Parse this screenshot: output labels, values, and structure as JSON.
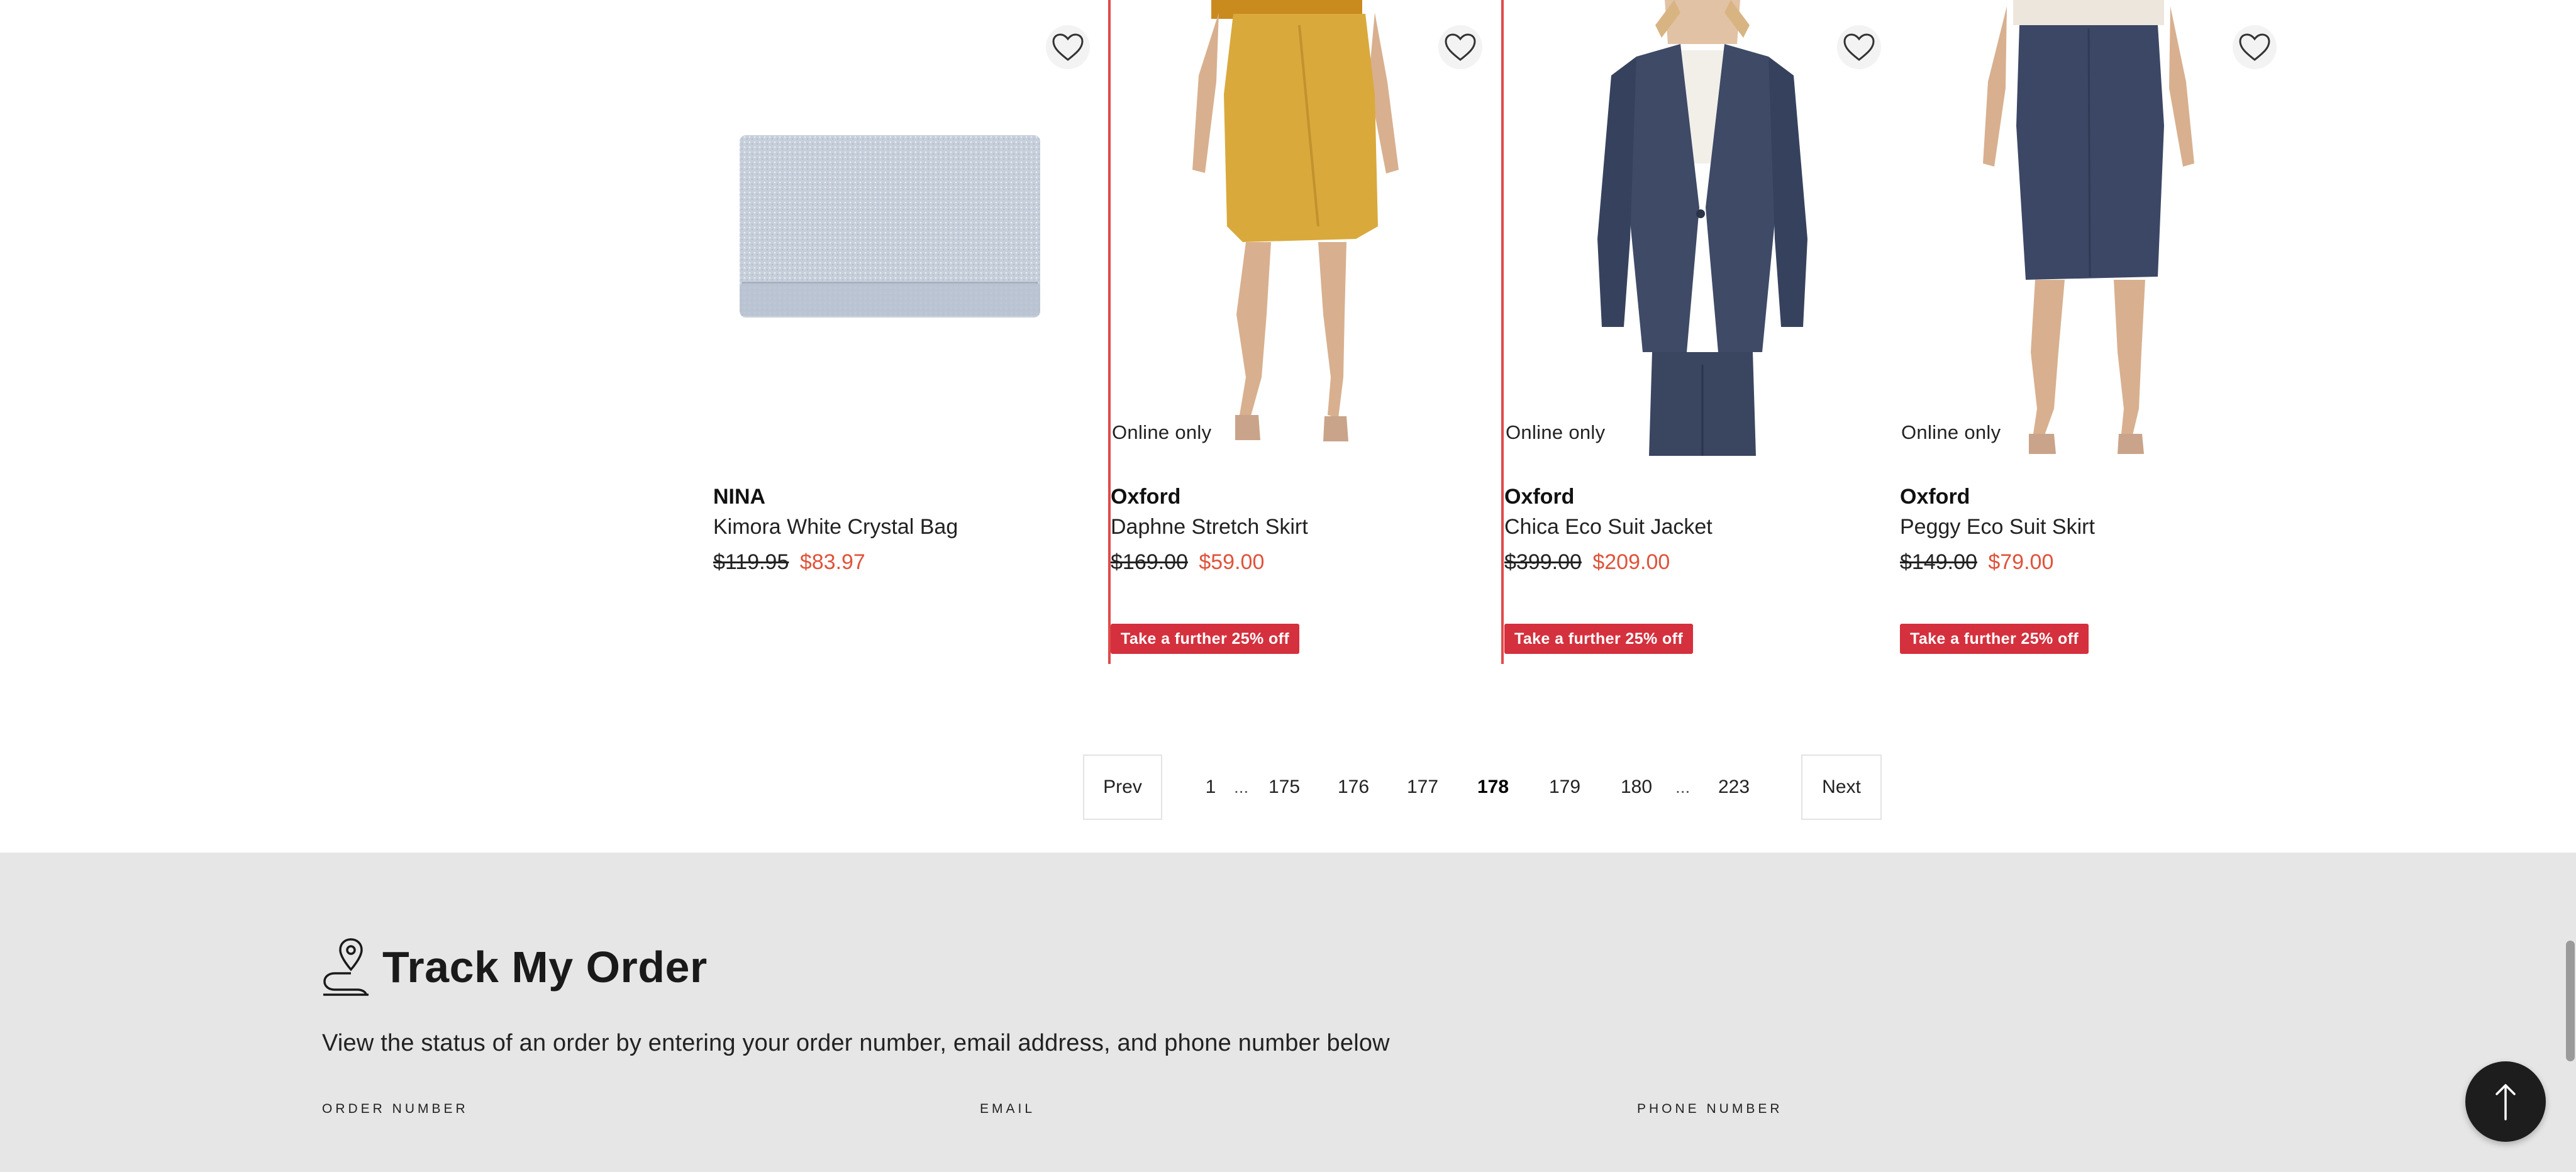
{
  "products": [
    {
      "brand": "NINA",
      "name": "Kimora White Crystal Bag",
      "price_old": "$119.95",
      "price_new": "$83.97",
      "online_badge": "",
      "promo": "",
      "image": "crystal-clutch-bag"
    },
    {
      "brand": "Oxford",
      "name": "Daphne Stretch Skirt",
      "price_old": "$169.00",
      "price_new": "$59.00",
      "online_badge": "Online only",
      "promo": "Take a further 25% off",
      "image": "mustard-wrap-skirt"
    },
    {
      "brand": "Oxford",
      "name": "Chica Eco Suit Jacket",
      "price_old": "$399.00",
      "price_new": "$209.00",
      "online_badge": "Online only",
      "promo": "Take a further 25% off",
      "image": "navy-suit-jacket"
    },
    {
      "brand": "Oxford",
      "name": "Peggy Eco Suit Skirt",
      "price_old": "$149.00",
      "price_new": "$79.00",
      "online_badge": "Online only",
      "promo": "Take a further 25% off",
      "image": "navy-pencil-skirt"
    }
  ],
  "pagination": {
    "prev": "Prev",
    "next": "Next",
    "pages": [
      "1",
      "175",
      "176",
      "177",
      "178",
      "179",
      "180",
      "223"
    ],
    "ellipsis": "...",
    "current": "178"
  },
  "track_order": {
    "title": "Track My Order",
    "description": "View the status of an order by entering your order number, email address, and phone number below",
    "fields": [
      {
        "label": "Order Number",
        "value": ""
      },
      {
        "label": "Email",
        "value": ""
      },
      {
        "label": "Phone Number",
        "value": ""
      }
    ]
  },
  "icons": {
    "wishlist": "heart-outline-icon",
    "track": "map-pin-route-icon",
    "scroll_top": "arrow-up-icon"
  },
  "colors": {
    "sale_price": "#e0533a",
    "promo_badge": "#d5303d",
    "highlight_border": "#e04a4a",
    "track_bg": "#e6e6e6"
  }
}
